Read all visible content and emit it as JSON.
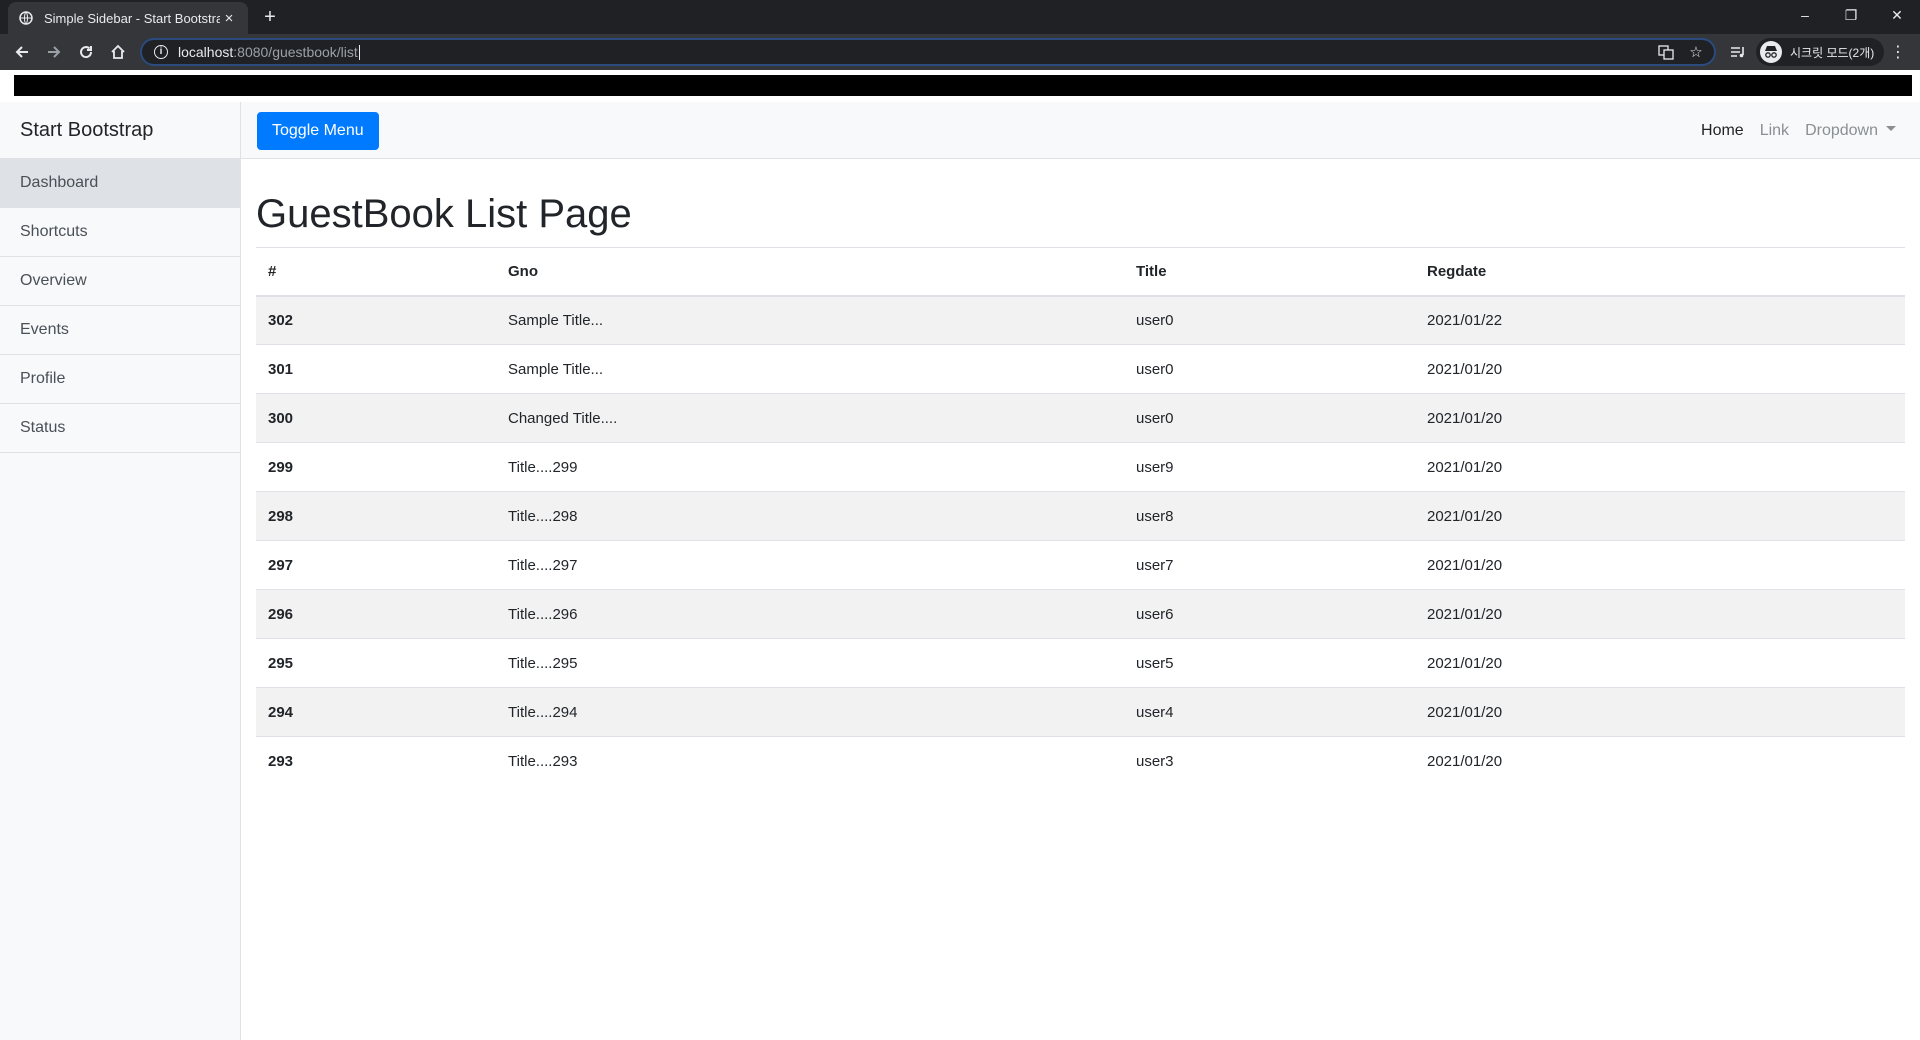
{
  "browser": {
    "tab_title": "Simple Sidebar - Start Bootstrap",
    "tab_close": "×",
    "new_tab": "+",
    "url_host": "localhost",
    "url_rest": ":8080/guestbook/list",
    "profile_label": "시크릿 모드(2개)",
    "window_controls": {
      "minimize": "–",
      "restore": "❐",
      "close": "✕"
    }
  },
  "sidebar": {
    "heading": "Start Bootstrap",
    "items": [
      {
        "label": "Dashboard"
      },
      {
        "label": "Shortcuts"
      },
      {
        "label": "Overview"
      },
      {
        "label": "Events"
      },
      {
        "label": "Profile"
      },
      {
        "label": "Status"
      }
    ]
  },
  "topnav": {
    "toggle_label": "Toggle Menu",
    "links": {
      "home": "Home",
      "link": "Link",
      "dropdown": "Dropdown"
    }
  },
  "main": {
    "title": "GuestBook List Page",
    "columns": [
      "#",
      "Gno",
      "Title",
      "Regdate"
    ],
    "rows": [
      {
        "num": "302",
        "gno": "Sample Title...",
        "title": "user0",
        "regdate": "2021/01/22"
      },
      {
        "num": "301",
        "gno": "Sample Title...",
        "title": "user0",
        "regdate": "2021/01/20"
      },
      {
        "num": "300",
        "gno": "Changed Title....",
        "title": "user0",
        "regdate": "2021/01/20"
      },
      {
        "num": "299",
        "gno": "Title....299",
        "title": "user9",
        "regdate": "2021/01/20"
      },
      {
        "num": "298",
        "gno": "Title....298",
        "title": "user8",
        "regdate": "2021/01/20"
      },
      {
        "num": "297",
        "gno": "Title....297",
        "title": "user7",
        "regdate": "2021/01/20"
      },
      {
        "num": "296",
        "gno": "Title....296",
        "title": "user6",
        "regdate": "2021/01/20"
      },
      {
        "num": "295",
        "gno": "Title....295",
        "title": "user5",
        "regdate": "2021/01/20"
      },
      {
        "num": "294",
        "gno": "Title....294",
        "title": "user4",
        "regdate": "2021/01/20"
      },
      {
        "num": "293",
        "gno": "Title....293",
        "title": "user3",
        "regdate": "2021/01/20"
      }
    ]
  },
  "colors": {
    "primary": "#007bff",
    "sidebar_bg": "#f8f9fa",
    "active_item_bg": "#dee2e6",
    "chrome_dark": "#202124"
  },
  "icons": {
    "favicon": "globe-icon",
    "back": "arrow-left-icon",
    "forward": "arrow-right-icon",
    "reload": "reload-icon",
    "home": "home-icon",
    "translate": "translate-icon",
    "bookmark": "star-icon",
    "media": "media-control-icon",
    "incognito": "incognito-icon",
    "menu": "kebab-menu-icon"
  }
}
